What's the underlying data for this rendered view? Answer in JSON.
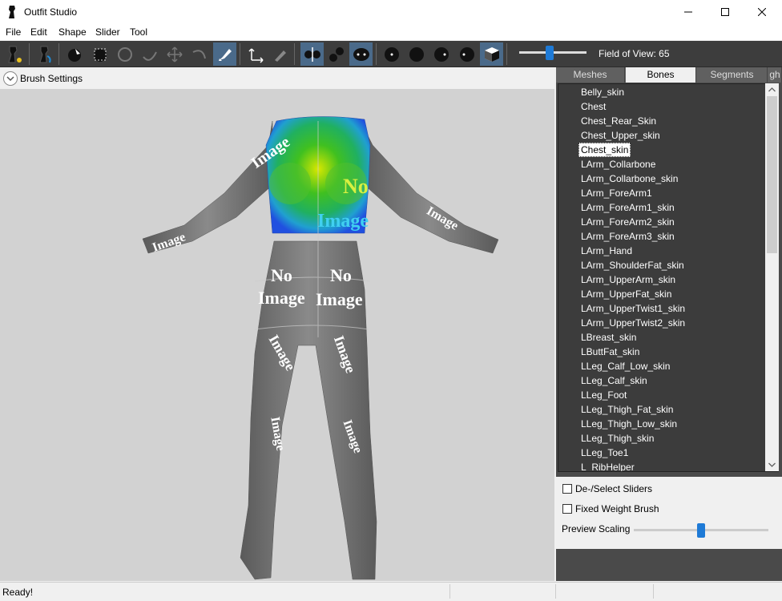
{
  "window": {
    "title": "Outfit Studio"
  },
  "menu": [
    "File",
    "Edit",
    "Shape",
    "Slider",
    "Tool"
  ],
  "toolbar": {
    "fov_label": "Field of View: 65",
    "fov_value": 65
  },
  "brush_settings": {
    "label": "Brush Settings"
  },
  "viewport": {
    "texture_text_1": "No",
    "texture_text_2": "Image"
  },
  "tabs": [
    "Meshes",
    "Bones",
    "Segments",
    "gh"
  ],
  "bones": [
    "Belly_skin",
    "Chest",
    "Chest_Rear_Skin",
    "Chest_Upper_skin",
    "Chest_skin",
    "LArm_Collarbone",
    "LArm_Collarbone_skin",
    "LArm_ForeArm1",
    "LArm_ForeArm1_skin",
    "LArm_ForeArm2_skin",
    "LArm_ForeArm3_skin",
    "LArm_Hand",
    "LArm_ShoulderFat_skin",
    "LArm_UpperArm_skin",
    "LArm_UpperFat_skin",
    "LArm_UpperTwist1_skin",
    "LArm_UpperTwist2_skin",
    "LBreast_skin",
    "LButtFat_skin",
    "LLeg_Calf_Low_skin",
    "LLeg_Calf_skin",
    "LLeg_Foot",
    "LLeg_Thigh_Fat_skin",
    "LLeg_Thigh_Low_skin",
    "LLeg_Thigh_skin",
    "LLeg_Toe1",
    "L_RibHelper"
  ],
  "selected_bone": "Chest_skin",
  "options": {
    "deselect_sliders": "De-/Select Sliders",
    "fixed_weight": "Fixed Weight Brush",
    "preview_scaling": "Preview Scaling"
  },
  "status": {
    "text": "Ready!"
  },
  "colors": {
    "toolbar_bg": "#3d3d3d",
    "panel_bg": "#4a4a4a",
    "accent": "#1e7ad6",
    "viewport_bg": "#d2d2d2"
  }
}
